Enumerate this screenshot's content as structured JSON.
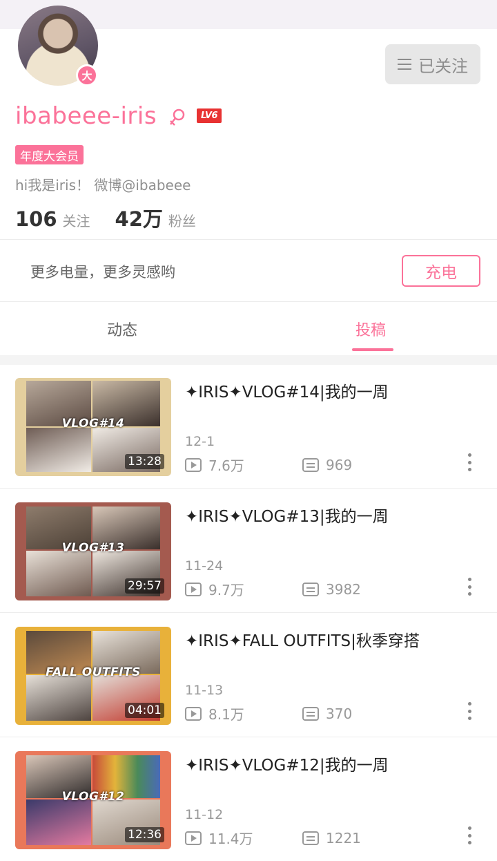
{
  "profile": {
    "username": "ibabeee-iris",
    "level": "LV6",
    "badge_char": "大",
    "vip_label": "年度大会员",
    "bio": "hi我是iris！ 微博@ibabeee",
    "following_count": "106",
    "following_label": "关注",
    "followers_count": "42万",
    "followers_label": "粉丝",
    "follow_button_label": "已关注"
  },
  "charge": {
    "text": "更多电量，更多灵感哟",
    "button_label": "充电"
  },
  "tabs": [
    {
      "label": "动态",
      "active": false
    },
    {
      "label": "投稿",
      "active": true
    }
  ],
  "videos": [
    {
      "title": "✦IRIS✦VLOG#14|我的一周",
      "date": "12-1",
      "views": "7.6万",
      "danmaku": "969",
      "duration": "13:28",
      "overlay": "VLOG#14",
      "frame_color": "#e4cf9e"
    },
    {
      "title": "✦IRIS✦VLOG#13|我的一周",
      "date": "11-24",
      "views": "9.7万",
      "danmaku": "3982",
      "duration": "29:57",
      "overlay": "VLOG#13",
      "frame_color": "#a45a4f"
    },
    {
      "title": "✦IRIS✦FALL OUTFITS|秋季穿搭",
      "date": "11-13",
      "views": "8.1万",
      "danmaku": "370",
      "duration": "04:01",
      "overlay": "FALL OUTFITS",
      "frame_color": "#e8b13a"
    },
    {
      "title": "✦IRIS✦VLOG#12|我的一周",
      "date": "11-12",
      "views": "11.4万",
      "danmaku": "1221",
      "duration": "12:36",
      "overlay": "VLOG#12",
      "frame_color": "#e9785a"
    }
  ],
  "colors": {
    "accent": "#fb7299",
    "level_badge": "#e83232"
  }
}
